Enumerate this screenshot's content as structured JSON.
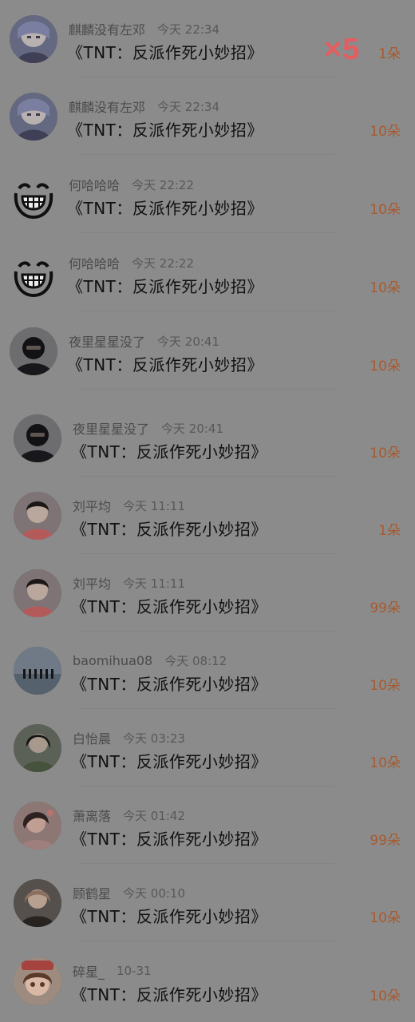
{
  "gift_feed": {
    "multiplier": "×5",
    "items": [
      {
        "name": "麒麟没有左邓",
        "time": "今天 22:34",
        "message": "《TNT：反派作死小妙招》",
        "count": "1朵"
      },
      {
        "name": "麒麟没有左邓",
        "time": "今天 22:34",
        "message": "《TNT：反派作死小妙招》",
        "count": "10朵"
      },
      {
        "name": "何哈哈哈",
        "time": "今天 22:22",
        "message": "《TNT：反派作死小妙招》",
        "count": "10朵"
      },
      {
        "name": "何哈哈哈",
        "time": "今天 22:22",
        "message": "《TNT：反派作死小妙招》",
        "count": "10朵"
      },
      {
        "name": "夜里星星没了",
        "time": "今天 20:41",
        "message": "《TNT：反派作死小妙招》",
        "count": "10朵"
      },
      {
        "name": "夜里星星没了",
        "time": "今天 20:41",
        "message": "《TNT：反派作死小妙招》",
        "count": "10朵"
      },
      {
        "name": "刘平均",
        "time": "今天 11:11",
        "message": "《TNT：反派作死小妙招》",
        "count": "1朵"
      },
      {
        "name": "刘平均",
        "time": "今天 11:11",
        "message": "《TNT：反派作死小妙招》",
        "count": "99朵"
      },
      {
        "name": "baomihua08",
        "time": "今天 08:12",
        "message": "《TNT：反派作死小妙招》",
        "count": "10朵"
      },
      {
        "name": "白怡晨",
        "time": "今天 03:23",
        "message": "《TNT：反派作死小妙招》",
        "count": "10朵"
      },
      {
        "name": "萧离落",
        "time": "今天 01:42",
        "message": "《TNT：反派作死小妙招》",
        "count": "99朵"
      },
      {
        "name": "顾鹤星",
        "time": "今天 00:10",
        "message": "《TNT：反派作死小妙招》",
        "count": "10朵"
      },
      {
        "name": "碎星_",
        "time": "10-31",
        "message": "《TNT：反派作死小妙招》",
        "count": "10朵"
      }
    ]
  },
  "icons": {
    "avatar_icons": [
      "anime-avatar-icon",
      "anime-avatar-icon",
      "grinning-face-avatar-icon",
      "grinning-face-avatar-icon",
      "masked-person-avatar-icon",
      "masked-person-avatar-icon",
      "portrait-avatar-icon",
      "portrait-avatar-icon",
      "lake-group-avatar-icon",
      "portrait-avatar-icon",
      "portrait-avatar-icon",
      "portrait-avatar-icon",
      "cartoon-girl-avatar-icon"
    ]
  },
  "colors": {
    "background": "#8b8b8b",
    "count": "#a85a2f",
    "multiplier": "#e45d61",
    "message": "#101010",
    "name": "#4b4b4b"
  }
}
